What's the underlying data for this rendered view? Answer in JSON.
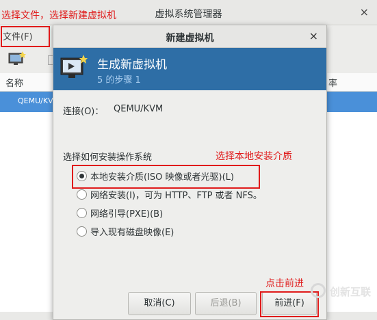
{
  "main_window": {
    "title": "虚拟系统管理器",
    "close": "×",
    "menu_file": "文件(F)",
    "list_header_name": "名称",
    "list_header_right": "率",
    "selected_row": "QEMU/KV"
  },
  "dialog": {
    "title": "新建虚拟机",
    "close": "×",
    "banner_title": "生成新虚拟机",
    "banner_subtitle": "5 的步骤 1",
    "connection_label": "连接(O)：",
    "connection_value": "QEMU/KVM",
    "choose_label": "选择如何安装操作系统",
    "options": [
      {
        "label": "本地安装介质(ISO 映像或者光驱)(L)",
        "checked": true
      },
      {
        "label": "网络安装(I)，可为  HTTP、FTP 或者  NFS。",
        "checked": false
      },
      {
        "label": "网络引导(PXE)(B)",
        "checked": false
      },
      {
        "label": "导入现有磁盘映像(E)",
        "checked": false
      }
    ],
    "buttons": {
      "cancel": "取消(C)",
      "back": "后退(B)",
      "forward": "前进(F)"
    }
  },
  "annotations": {
    "file_note": "选择文件，选择新建虚拟机",
    "local_note": "选择本地安装介质",
    "next_note": "点击前进",
    "color": "#e01b1b"
  },
  "watermark": {
    "text": "创新互联"
  },
  "colors": {
    "banner": "#2e6ea6",
    "selection": "#4a90d9"
  }
}
